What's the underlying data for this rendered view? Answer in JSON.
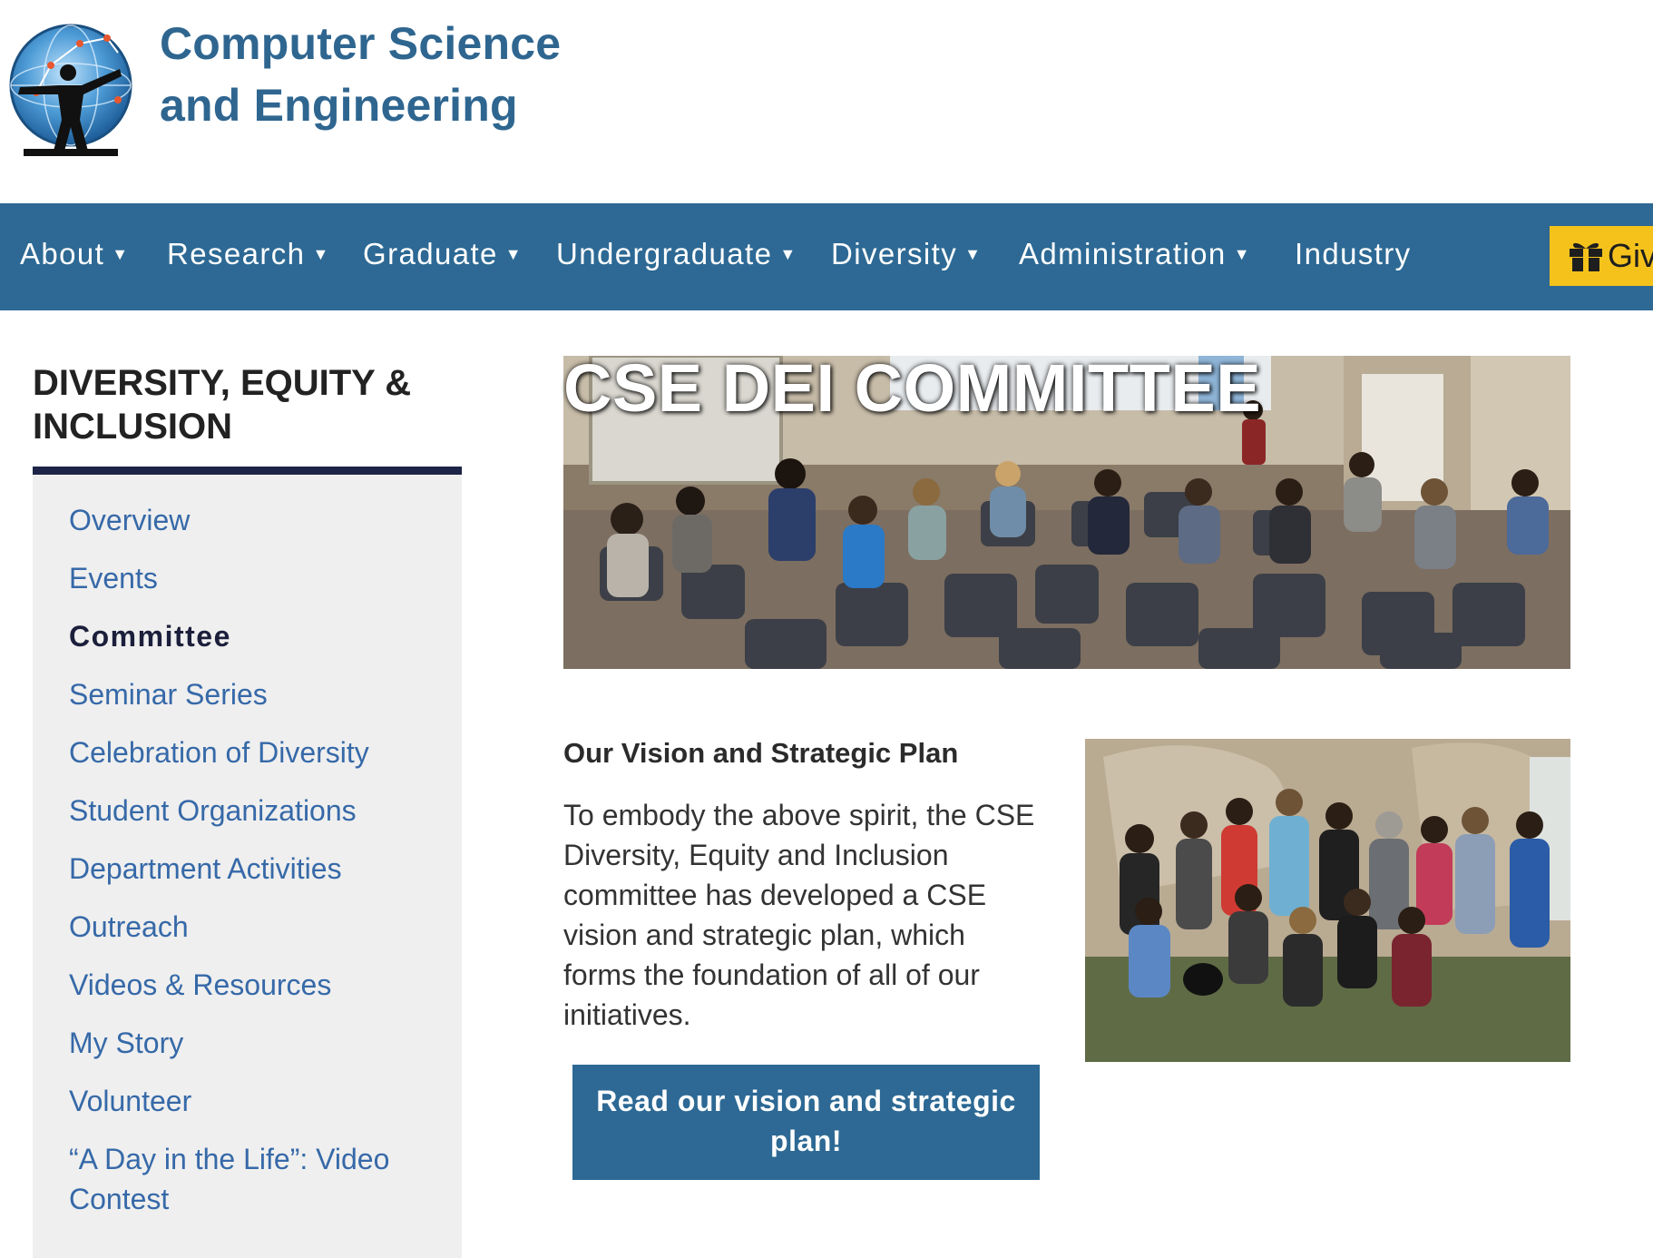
{
  "header": {
    "title_line1": "Computer Science",
    "title_line2": "and Engineering"
  },
  "nav": {
    "items": [
      {
        "label": "About",
        "has_dropdown": true
      },
      {
        "label": "Research",
        "has_dropdown": true
      },
      {
        "label": "Graduate",
        "has_dropdown": true
      },
      {
        "label": "Undergraduate",
        "has_dropdown": true
      },
      {
        "label": "Diversity",
        "has_dropdown": true
      },
      {
        "label": "Administration",
        "has_dropdown": true
      },
      {
        "label": "Industry",
        "has_dropdown": false
      }
    ],
    "caret": "▼",
    "give_label": "Give",
    "give_icon": "gift-icon"
  },
  "sidebar": {
    "heading": "DIVERSITY, EQUITY & INCLUSION",
    "items": [
      {
        "label": "Overview",
        "active": false
      },
      {
        "label": "Events",
        "active": false
      },
      {
        "label": "Committee",
        "active": true
      },
      {
        "label": "Seminar Series",
        "active": false
      },
      {
        "label": "Celebration of Diversity",
        "active": false
      },
      {
        "label": "Student Organizations",
        "active": false
      },
      {
        "label": "Department Activities",
        "active": false
      },
      {
        "label": "Outreach",
        "active": false
      },
      {
        "label": "Videos & Resources",
        "active": false
      },
      {
        "label": "My Story",
        "active": false
      },
      {
        "label": "Volunteer",
        "active": false
      },
      {
        "label": "“A Day in the Life”: Video Contest",
        "active": false
      }
    ]
  },
  "main": {
    "hero_title": "CSE DEI COMMITTEE",
    "vision_heading": "Our Vision and Strategic Plan",
    "vision_text": "To embody the above spirit, the CSE Diversity, Equity and Inclusion committee has developed a CSE vision and strategic plan, which forms the foundation of all of our initiatives.",
    "cta_label": "Read our vision and strategic plan!"
  },
  "colors": {
    "brand_blue": "#2d6994",
    "title_blue": "#2f6690",
    "link_blue": "#3669a8",
    "give_yellow": "#f5c21b",
    "sidebar_rule": "#1d2447",
    "sidebar_bg": "#efefef"
  }
}
